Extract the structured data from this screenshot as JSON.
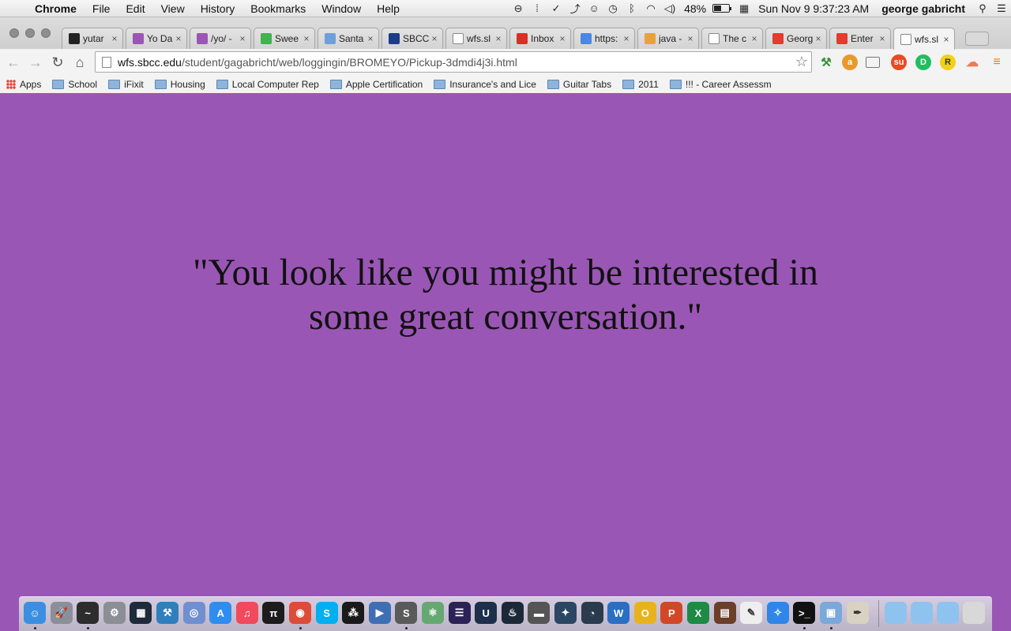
{
  "menubar": {
    "app_name": "Chrome",
    "menus": [
      "File",
      "Edit",
      "View",
      "History",
      "Bookmarks",
      "Window",
      "Help"
    ],
    "battery_percent": "48%",
    "battery_level": 0.48,
    "datetime": "Sun Nov 9  9:37:23 AM",
    "user": "george gabricht"
  },
  "tabs": [
    {
      "title": "yutar",
      "icon": "github-icon",
      "color": "#222222"
    },
    {
      "title": "Yo Da",
      "icon": "purple-square-icon",
      "color": "#9a56b5"
    },
    {
      "title": "/yo/ -",
      "icon": "purple-square-icon",
      "color": "#9a56b5"
    },
    {
      "title": "Swee",
      "icon": "green-u-icon",
      "color": "#3fb34f"
    },
    {
      "title": "Santa",
      "icon": "grid-icon",
      "color": "#6f9fd8"
    },
    {
      "title": "SBCC",
      "icon": "circle-logo-icon",
      "color": "#1b3d86"
    },
    {
      "title": "wfs.sl",
      "icon": "page-icon",
      "color": "#ffffff"
    },
    {
      "title": "Inbox",
      "icon": "gmail-icon",
      "color": "#d93025"
    },
    {
      "title": "https:",
      "icon": "google-icon",
      "color": "#4a86e8"
    },
    {
      "title": "java -",
      "icon": "stack-icon",
      "color": "#e8a23a"
    },
    {
      "title": "The c",
      "icon": "page-icon",
      "color": "#ffffff"
    },
    {
      "title": "Georg",
      "icon": "pinwheel-icon",
      "color": "#e33b2e"
    },
    {
      "title": "Enter",
      "icon": "pinwheel-icon",
      "color": "#e33b2e"
    },
    {
      "title": "wfs.sl",
      "icon": "page-icon",
      "color": "#ffffff",
      "active": true
    }
  ],
  "address": {
    "host": "wfs.sbcc.edu",
    "path": "/student/gagabricht/web/loggingin/BROMEYO/Pickup-3dmdi4j3i.html"
  },
  "bookmarks": [
    {
      "label": "Apps",
      "icon": "apps-grid-icon"
    },
    {
      "label": "School",
      "icon": "folder-icon"
    },
    {
      "label": "iFixit",
      "icon": "folder-icon"
    },
    {
      "label": "Housing",
      "icon": "folder-icon"
    },
    {
      "label": "Local Computer Rep",
      "icon": "folder-icon"
    },
    {
      "label": "Apple Certification",
      "icon": "folder-icon"
    },
    {
      "label": "Insurance's and Lice",
      "icon": "folder-icon"
    },
    {
      "label": "Guitar Tabs",
      "icon": "folder-icon"
    },
    {
      "label": "2011",
      "icon": "folder-icon"
    },
    {
      "label": "!!! - Career Assessm",
      "icon": "folder-icon"
    }
  ],
  "page": {
    "background": "#9a56b5",
    "quote": "\"You look like you might be interested in some great conversation.\""
  },
  "dock_apps": [
    {
      "name": "finder-icon",
      "color": "#3b8fe0",
      "glyph": "☺",
      "running": true
    },
    {
      "name": "launchpad-icon",
      "color": "#8a8f99",
      "glyph": "🚀",
      "running": false
    },
    {
      "name": "activity-monitor-icon",
      "color": "#2d2d2d",
      "glyph": "~",
      "running": true
    },
    {
      "name": "system-preferences-icon",
      "color": "#8b8f95",
      "glyph": "⚙",
      "running": false
    },
    {
      "name": "photo-booth-icon",
      "color": "#1f2a3a",
      "glyph": "▦",
      "running": false
    },
    {
      "name": "xcode-icon",
      "color": "#2f7fbd",
      "glyph": "⚒",
      "running": false
    },
    {
      "name": "network-icon",
      "color": "#6f8fd0",
      "glyph": "◎",
      "running": false
    },
    {
      "name": "app-store-icon",
      "color": "#2e8df0",
      "glyph": "A",
      "running": false
    },
    {
      "name": "itunes-icon",
      "color": "#f04a5c",
      "glyph": "♫",
      "running": false
    },
    {
      "name": "pi-icon",
      "color": "#1c1c1c",
      "glyph": "π",
      "running": false
    },
    {
      "name": "chrome-icon",
      "color": "#dd4b39",
      "glyph": "◉",
      "running": true
    },
    {
      "name": "skype-icon",
      "color": "#00aff0",
      "glyph": "S",
      "running": false
    },
    {
      "name": "grid-app-icon",
      "color": "#1a1a1a",
      "glyph": "⁂",
      "running": false
    },
    {
      "name": "quicktime-icon",
      "color": "#3e6fb5",
      "glyph": "▶",
      "running": false
    },
    {
      "name": "sublime-text-icon",
      "color": "#5a5a5a",
      "glyph": "S",
      "running": true
    },
    {
      "name": "atom-icon",
      "color": "#66a872",
      "glyph": "⚛",
      "running": false
    },
    {
      "name": "eclipse-icon",
      "color": "#2c2255",
      "glyph": "☰",
      "running": false
    },
    {
      "name": "unreal-icon",
      "color": "#1d2f4a",
      "glyph": "U",
      "running": false
    },
    {
      "name": "steam-icon",
      "color": "#1b2838",
      "glyph": "♨",
      "running": false
    },
    {
      "name": "disk-icon",
      "color": "#555555",
      "glyph": "▬",
      "running": false
    },
    {
      "name": "blender-icon",
      "color": "#2a4663",
      "glyph": "✦",
      "running": false
    },
    {
      "name": "instruments-icon",
      "color": "#2a3b4e",
      "glyph": "◔",
      "running": false
    },
    {
      "name": "word-icon",
      "color": "#2a6fc4",
      "glyph": "W",
      "running": false
    },
    {
      "name": "omnigraffle-icon",
      "color": "#e8b21f",
      "glyph": "O",
      "running": false
    },
    {
      "name": "powerpoint-icon",
      "color": "#d24726",
      "glyph": "P",
      "running": false
    },
    {
      "name": "excel-icon",
      "color": "#1e8a44",
      "glyph": "X",
      "running": false
    },
    {
      "name": "ebook-icon",
      "color": "#6b3f2a",
      "glyph": "▤",
      "running": false
    },
    {
      "name": "textedit-icon",
      "color": "#eeeeee",
      "glyph": "✎",
      "running": false
    },
    {
      "name": "safari-icon",
      "color": "#2f86e8",
      "glyph": "✧",
      "running": false
    },
    {
      "name": "terminal-icon",
      "color": "#111111",
      "glyph": ">_",
      "running": true
    },
    {
      "name": "preview-icon",
      "color": "#7aa8d8",
      "glyph": "▣",
      "running": true
    },
    {
      "name": "pen-app-icon",
      "color": "#d9d2c3",
      "glyph": "✒",
      "running": false
    }
  ],
  "dock_stacks": [
    {
      "name": "applications-folder-icon",
      "color": "#8fc3ef"
    },
    {
      "name": "documents-folder-icon",
      "color": "#8fc3ef"
    },
    {
      "name": "downloads-folder-icon",
      "color": "#8fc3ef"
    },
    {
      "name": "trash-icon",
      "color": "#d8d8d8"
    }
  ]
}
